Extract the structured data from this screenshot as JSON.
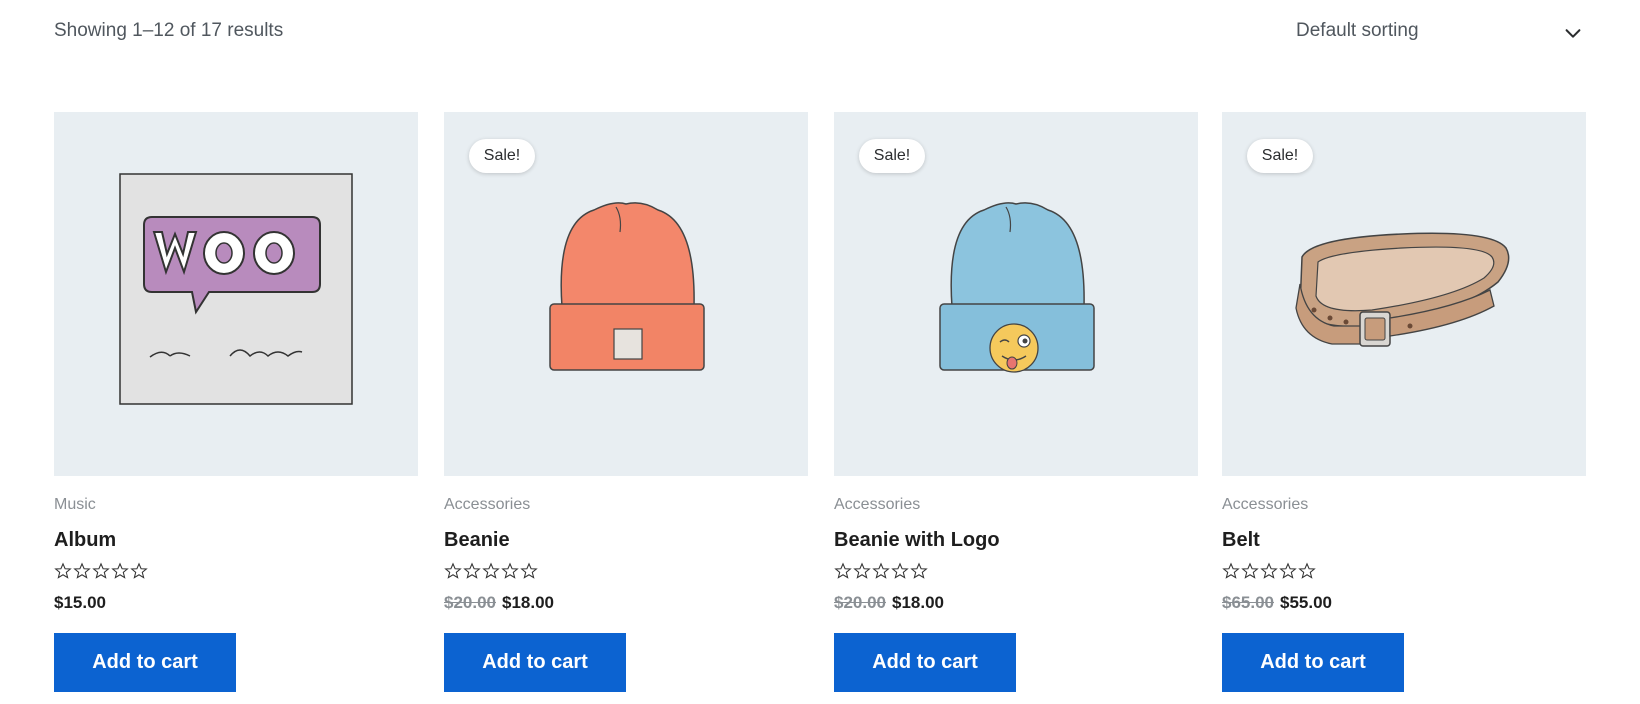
{
  "toolbar": {
    "result_count": "Showing 1–12 of 17 results",
    "sorting": {
      "selected": "Default sorting",
      "icon": "chevron-down-icon"
    }
  },
  "products": [
    {
      "category": "Music",
      "title": "Album",
      "sale_badge": "",
      "regular_price": "",
      "price": "$15.00",
      "rating": 0,
      "button": "Add to cart",
      "image": "woo-album-artwork"
    },
    {
      "category": "Accessories",
      "title": "Beanie",
      "sale_badge": "Sale!",
      "regular_price": "$20.00",
      "price": "$18.00",
      "rating": 0,
      "button": "Add to cart",
      "image": "orange-beanie"
    },
    {
      "category": "Accessories",
      "title": "Beanie with Logo",
      "sale_badge": "Sale!",
      "regular_price": "$20.00",
      "price": "$18.00",
      "rating": 0,
      "button": "Add to cart",
      "image": "blue-beanie-with-logo"
    },
    {
      "category": "Accessories",
      "title": "Belt",
      "sale_badge": "Sale!",
      "regular_price": "$65.00",
      "price": "$55.00",
      "rating": 0,
      "button": "Add to cart",
      "image": "leather-belt"
    }
  ],
  "colors": {
    "button": "#0c63d1",
    "thumb_bg": "#e8eef2",
    "muted_text": "#8a8f94"
  }
}
